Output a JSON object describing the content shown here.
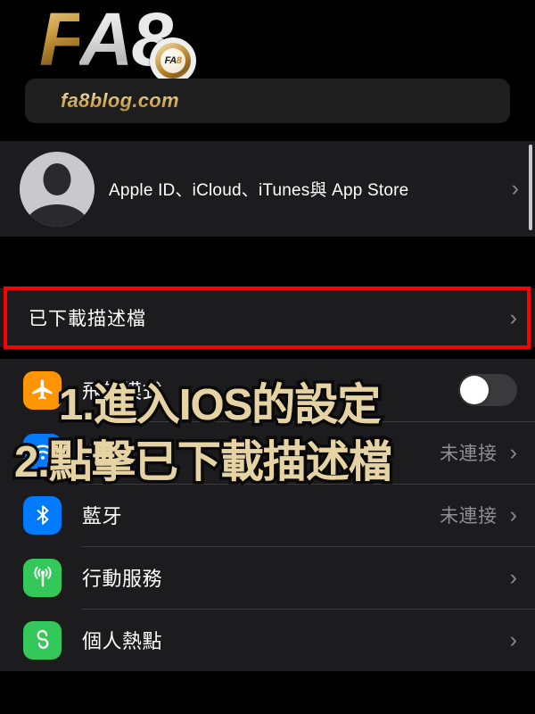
{
  "branding": {
    "logo_f": "F",
    "logo_a": "A",
    "logo_8": "8",
    "badge_text_fa": "FA",
    "badge_text_8": "8",
    "url": "fa8blog.com"
  },
  "settings": {
    "apple_id": {
      "label": "Apple ID、iCloud、iTunes與 App Store",
      "avatar_icon": "person-circle-icon",
      "chevron": "chevron-right-icon"
    },
    "profile_row": {
      "label": "已下載描述檔",
      "chevron": "chevron-right-icon",
      "highlight_color": "#FF0000"
    },
    "rows": [
      {
        "label": "飛航模式",
        "icon": "airplane-icon",
        "icon_color": "#FF9500",
        "control": "toggle",
        "toggle_on": false,
        "value": ""
      },
      {
        "label": "Wi-Fi",
        "icon": "wifi-icon",
        "icon_color": "#007AFF",
        "control": "value",
        "value": "未連接"
      },
      {
        "label": "藍牙",
        "icon": "bluetooth-icon",
        "icon_color": "#007AFF",
        "control": "value",
        "value": "未連接"
      },
      {
        "label": "行動服務",
        "icon": "cellular-icon",
        "icon_color": "#34C759",
        "control": "chevron",
        "value": ""
      },
      {
        "label": "個人熱點",
        "icon": "hotspot-icon",
        "icon_color": "#34C759",
        "control": "chevron",
        "value": ""
      }
    ]
  },
  "overlay": {
    "line1": "1.進入IOS的設定",
    "line2": "2.點擊已下載描述檔",
    "text_color": "#E6D3A3",
    "stroke_color": "#0A0A0A"
  }
}
